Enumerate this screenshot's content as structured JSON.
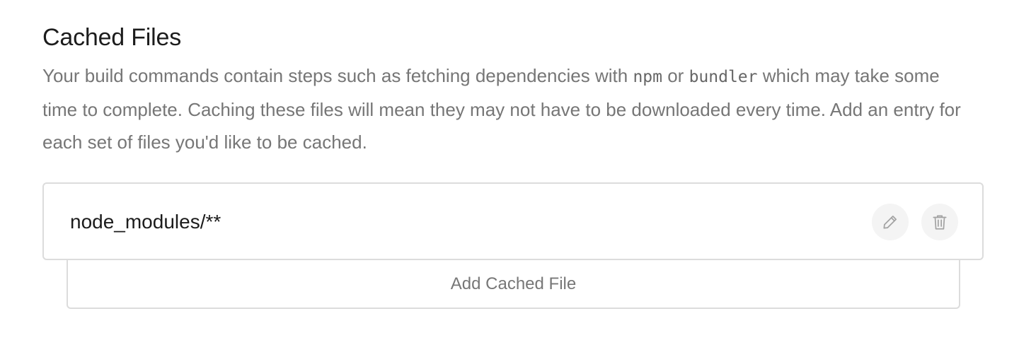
{
  "section": {
    "title": "Cached Files",
    "description": {
      "part1": "Your build commands contain steps such as fetching dependencies with ",
      "code1": "npm",
      "part2": " or ",
      "code2": "bundler",
      "part3": " which may take some time to complete. Caching these files will mean they may not have to be downloaded every time. Add an entry for each set of files you'd like to be cached."
    }
  },
  "entries": [
    {
      "path": "node_modules/**",
      "edit_icon": "pencil-icon",
      "delete_icon": "trash-icon"
    }
  ],
  "add_button": {
    "label": "Add Cached File"
  },
  "colors": {
    "title": "#1c1c1c",
    "description": "#767676",
    "border": "#dcdcdc",
    "icon_bg": "#f4f4f4",
    "icon": "#a3a3a3"
  }
}
